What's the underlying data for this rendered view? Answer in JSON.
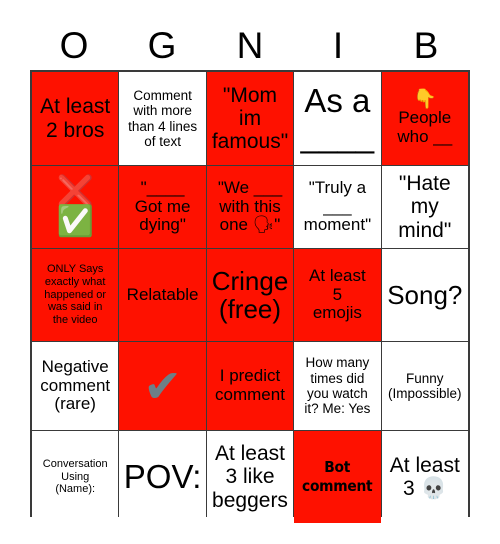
{
  "card": {
    "title_letters": [
      "O",
      "G",
      "N",
      "I",
      "B"
    ],
    "colors": {
      "red": "#fe1100",
      "white": "#ffffff",
      "border": "#3a3a3a",
      "text": "#000000"
    },
    "rows": [
      [
        {
          "text": "At least\n2 bros",
          "fill": "red",
          "size": "t-lg"
        },
        {
          "text": "Comment\nwith more\nthan 4 lines\nof text",
          "fill": "white",
          "size": "t-sm"
        },
        {
          "text": "\"Mom\nim\nfamous\"",
          "fill": "red",
          "size": "t-lg"
        },
        {
          "text": "As a\n____",
          "fill": "white",
          "size": "t-xxl"
        },
        {
          "text": "People\nwho __",
          "fill": "red",
          "size": "t-md",
          "emoji": "👇",
          "emoji_name": "backhand-index-pointing-down-emoji",
          "emoji_size": 19
        }
      ],
      [
        {
          "text": "",
          "fill": "red",
          "size": "t-md",
          "emoji_stack": [
            "❌",
            "✅"
          ],
          "emoji_stack_names": [
            "cross-mark-emoji",
            "check-mark-button-emoji"
          ],
          "emoji_size": 30
        },
        {
          "text": "\"____\nGot me\ndying\"",
          "fill": "red",
          "size": "t-md"
        },
        {
          "text": "\"We ___\nwith this\none 🗣\"",
          "fill": "red",
          "size": "t-md"
        },
        {
          "text": "\"Truly a\n___\nmoment\"",
          "fill": "white",
          "size": "t-md"
        },
        {
          "text": "\"Hate\nmy\nmind\"",
          "fill": "white",
          "size": "t-lg"
        }
      ],
      [
        {
          "text": "ONLY Says\nexactly what\nhappened or\nwas said in\nthe video",
          "fill": "red",
          "size": "t-xs"
        },
        {
          "text": "Relatable",
          "fill": "red",
          "size": "t-md"
        },
        {
          "text": "Cringe\n(free)",
          "fill": "red",
          "size": "t-xl"
        },
        {
          "text": "At least\n5\nemojis",
          "fill": "red",
          "size": "t-md"
        },
        {
          "text": "Song?",
          "fill": "white",
          "size": "t-xl"
        }
      ],
      [
        {
          "text": "Negative\ncomment\n(rare)",
          "fill": "white",
          "size": "t-md"
        },
        {
          "text": "",
          "fill": "red",
          "size": "t-md",
          "emoji": "✔",
          "emoji_name": "heavy-check-mark-emoji",
          "emoji_size": 46,
          "emoji_color": "#6e7f87"
        },
        {
          "text": "I predict\ncomment",
          "fill": "red",
          "size": "t-md"
        },
        {
          "text": "How many\ntimes did\nyou watch\nit? Me: Yes",
          "fill": "white",
          "size": "t-sm"
        },
        {
          "text": "Funny\n(Impossible)",
          "fill": "white",
          "size": "t-sm"
        }
      ],
      [
        {
          "text": "Conversation\nUsing\n(Name):",
          "fill": "white",
          "size": "t-xs"
        },
        {
          "text": "POV:",
          "fill": "white",
          "size": "t-xxl"
        },
        {
          "text": "At least\n3 like\nbeggers",
          "fill": "white",
          "size": "t-lg"
        },
        {
          "text": "Bot\ncomment",
          "fill": "red",
          "size": "bold-condensed"
        },
        {
          "text": "At least\n3 💀",
          "fill": "white",
          "size": "t-lg"
        }
      ]
    ]
  }
}
